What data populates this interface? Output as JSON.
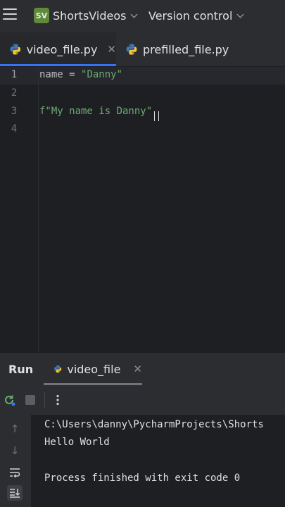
{
  "toolbar": {
    "project_initials": "SV",
    "project_name": "ShortsVideos",
    "vcs_label": "Version control"
  },
  "tabs": [
    {
      "label": "video_file.py",
      "active": true
    },
    {
      "label": "prefilled_file.py",
      "active": false
    }
  ],
  "editor": {
    "line_numbers": [
      "1",
      "2",
      "3",
      "4"
    ],
    "lines": [
      {
        "plain": "name = ",
        "string": "\"Danny\""
      },
      {
        "plain": "",
        "string": ""
      },
      {
        "plain": "",
        "string": "f\"My name is Danny\""
      },
      {
        "plain": "",
        "string": ""
      }
    ]
  },
  "run_panel": {
    "title": "Run",
    "tab_label": "video_file",
    "console_lines": [
      "C:\\Users\\danny\\PycharmProjects\\Shorts",
      "Hello World",
      "",
      "Process finished with exit code 0"
    ]
  },
  "icons": {
    "menu": "hamburger-menu-icon",
    "python": "python-file-icon",
    "rerun": "rerun-icon",
    "stop": "stop-icon",
    "more": "more-options-icon"
  },
  "colors": {
    "accent": "#3574f0",
    "string": "#6aab73",
    "project_badge": "#5f8a3c"
  }
}
